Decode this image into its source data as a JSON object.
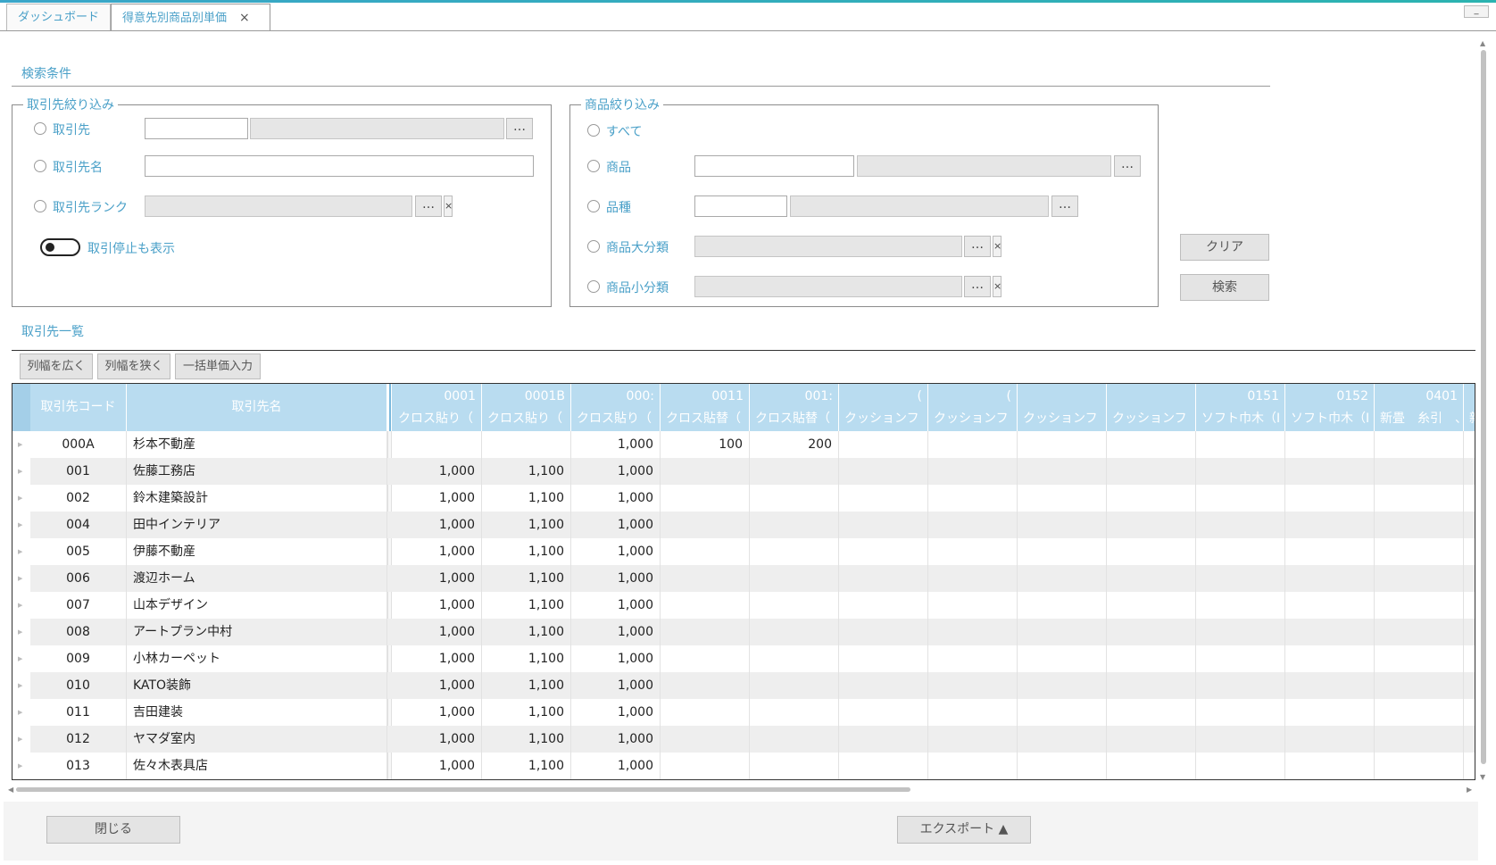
{
  "tabs": [
    {
      "label": "ダッシュボード",
      "active": false
    },
    {
      "label": "得意先別商品別単価",
      "active": true,
      "close": "×"
    }
  ],
  "window": {
    "minimize": "_"
  },
  "search": {
    "title": "検索条件",
    "customer_filter": {
      "legend": "取引先絞り込み",
      "rows": [
        {
          "label": "取引先",
          "code_value": "",
          "name_value": "",
          "browse": "…"
        },
        {
          "label": "取引先名",
          "value": ""
        },
        {
          "label": "取引先ランク",
          "value": "",
          "browse": "…",
          "clear": "×"
        }
      ],
      "toggle_label": "取引停止も表示",
      "toggle_on": false
    },
    "product_filter": {
      "legend": "商品絞り込み",
      "rows": [
        {
          "label": "すべて"
        },
        {
          "label": "商品",
          "code_value": "",
          "name_value": "",
          "browse": "…"
        },
        {
          "label": "品種",
          "code_value": "",
          "name_value": "",
          "browse": "…"
        },
        {
          "label": "商品大分類",
          "value": "",
          "browse": "…",
          "clear": "×"
        },
        {
          "label": "商品小分類",
          "value": "",
          "browse": "…",
          "clear": "×"
        }
      ]
    },
    "clear_label": "クリア",
    "search_label": "検索"
  },
  "list": {
    "title": "取引先一覧",
    "toolbar": {
      "widen": "列幅を広く",
      "narrow": "列幅を狭く",
      "bulk": "一括単価入力"
    },
    "headers": {
      "code": "取引先コード",
      "name": "取引先名"
    },
    "product_columns": [
      {
        "code": "0001",
        "name": "クロス貼り（"
      },
      {
        "code": "0001B",
        "name": "クロス貼り（"
      },
      {
        "code": "000:",
        "name": "クロス貼り（"
      },
      {
        "code": "0011",
        "name": "クロス貼替（"
      },
      {
        "code": "001:",
        "name": "クロス貼替（"
      },
      {
        "code": "(",
        "name": "クッションフ"
      },
      {
        "code": "(",
        "name": "クッションフ"
      },
      {
        "code": "",
        "name": "クッションフ"
      },
      {
        "code": "",
        "name": "クッションフ"
      },
      {
        "code": "0151",
        "name": "ソフト巾木（I"
      },
      {
        "code": "0152",
        "name": "ソフト巾木（I"
      },
      {
        "code": "0401",
        "name": "新畳　糸引　、"
      },
      {
        "code": "",
        "name": "新"
      }
    ],
    "rows": [
      {
        "code": "000A",
        "name": "杉本不動産",
        "values": [
          "",
          "",
          "1,000",
          "100",
          "200",
          "",
          "",
          "",
          "",
          "",
          "",
          "",
          ""
        ]
      },
      {
        "code": "001",
        "name": "佐藤工務店",
        "values": [
          "1,000",
          "1,100",
          "1,000",
          "",
          "",
          "",
          "",
          "",
          "",
          "",
          "",
          "",
          ""
        ]
      },
      {
        "code": "002",
        "name": "鈴木建築設計",
        "values": [
          "1,000",
          "1,100",
          "1,000",
          "",
          "",
          "",
          "",
          "",
          "",
          "",
          "",
          "",
          ""
        ]
      },
      {
        "code": "004",
        "name": "田中インテリア",
        "values": [
          "1,000",
          "1,100",
          "1,000",
          "",
          "",
          "",
          "",
          "",
          "",
          "",
          "",
          "",
          ""
        ]
      },
      {
        "code": "005",
        "name": "伊藤不動産",
        "values": [
          "1,000",
          "1,100",
          "1,000",
          "",
          "",
          "",
          "",
          "",
          "",
          "",
          "",
          "",
          ""
        ]
      },
      {
        "code": "006",
        "name": "渡辺ホーム",
        "values": [
          "1,000",
          "1,100",
          "1,000",
          "",
          "",
          "",
          "",
          "",
          "",
          "",
          "",
          "",
          ""
        ]
      },
      {
        "code": "007",
        "name": "山本デザイン",
        "values": [
          "1,000",
          "1,100",
          "1,000",
          "",
          "",
          "",
          "",
          "",
          "",
          "",
          "",
          "",
          ""
        ]
      },
      {
        "code": "008",
        "name": "アートプラン中村",
        "values": [
          "1,000",
          "1,100",
          "1,000",
          "",
          "",
          "",
          "",
          "",
          "",
          "",
          "",
          "",
          ""
        ]
      },
      {
        "code": "009",
        "name": "小林カーペット",
        "values": [
          "1,000",
          "1,100",
          "1,000",
          "",
          "",
          "",
          "",
          "",
          "",
          "",
          "",
          "",
          ""
        ]
      },
      {
        "code": "010",
        "name": "KATO装飾",
        "values": [
          "1,000",
          "1,100",
          "1,000",
          "",
          "",
          "",
          "",
          "",
          "",
          "",
          "",
          "",
          ""
        ]
      },
      {
        "code": "011",
        "name": "吉田建装",
        "values": [
          "1,000",
          "1,100",
          "1,000",
          "",
          "",
          "",
          "",
          "",
          "",
          "",
          "",
          "",
          ""
        ]
      },
      {
        "code": "012",
        "name": "ヤマダ室内",
        "values": [
          "1,000",
          "1,100",
          "1,000",
          "",
          "",
          "",
          "",
          "",
          "",
          "",
          "",
          "",
          ""
        ]
      },
      {
        "code": "013",
        "name": "佐々木表具店",
        "values": [
          "1,000",
          "1,100",
          "1,000",
          "",
          "",
          "",
          "",
          "",
          "",
          "",
          "",
          "",
          ""
        ]
      }
    ]
  },
  "footer": {
    "close_label": "閉じる",
    "export_label": "エクスポート ▲"
  },
  "colors": {
    "accent_text": "#4aa0c8",
    "header_bg": "#b9dcf0",
    "alt_row": "#eeeeee"
  }
}
